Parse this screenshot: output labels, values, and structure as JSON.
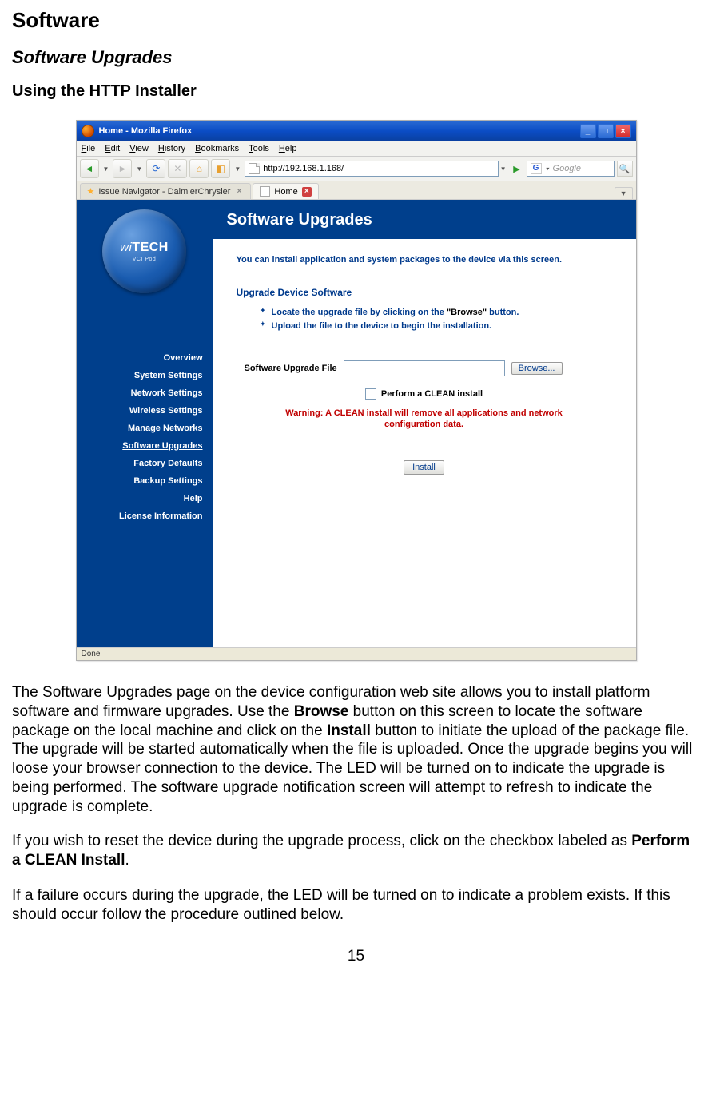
{
  "doc": {
    "h1": "Software",
    "h2": "Software Upgrades",
    "h3": "Using the HTTP Installer",
    "para1_a": "The Software Upgrades page on the device configuration web site allows you to install platform software and firmware upgrades.  Use the ",
    "para1_browse": "Browse",
    "para1_b": " button on this screen to locate the software package on the local machine and click on the ",
    "para1_install": "Install",
    "para1_c": " button to initiate the upload of the package file.  The upgrade will be started automatically when the file is uploaded.  Once the upgrade begins you will loose your browser connection to the device.  The LED will be turned on to indicate the upgrade is being performed.  The software upgrade notification screen will attempt to refresh to indicate the upgrade is complete.",
    "para2_a": "If you wish to reset the device during the upgrade process, click on the checkbox labeled as ",
    "para2_bold": "Perform a CLEAN Install",
    "para2_b": ".",
    "para3": "If a failure occurs during the upgrade, the LED will be turned on to indicate a problem exists.  If this should occur follow the procedure outlined below.",
    "page_num": "15"
  },
  "browser": {
    "title": "Home - Mozilla Firefox",
    "menu": [
      "File",
      "Edit",
      "View",
      "History",
      "Bookmarks",
      "Tools",
      "Help"
    ],
    "url": "http://192.168.1.168/",
    "search_placeholder": "Google",
    "tabs": {
      "inactive": "Issue Navigator - DaimlerChrysler",
      "active": "Home"
    },
    "status": "Done"
  },
  "ui": {
    "logo_main": "wiTECH",
    "logo_sub": "VCI Pod",
    "panel_title": "Software Upgrades",
    "intro": "You can install application and system packages to the device via this screen.",
    "section": "Upgrade Device Software",
    "bullet1_a": "Locate the upgrade file by clicking on the ",
    "bullet1_q": "\"Browse\"",
    "bullet1_b": " button.",
    "bullet2": "Upload the file to the device to begin the installation.",
    "file_label": "Software Upgrade File",
    "browse_btn": "Browse...",
    "clean_label": "Perform a CLEAN install",
    "warning": "Warning: A CLEAN install will remove all applications and network configuration data.",
    "install_btn": "Install",
    "nav": [
      {
        "label": "Overview",
        "selected": false
      },
      {
        "label": "System Settings",
        "selected": false
      },
      {
        "label": "Network Settings",
        "selected": false
      },
      {
        "label": "Wireless Settings",
        "selected": false
      },
      {
        "label": "Manage Networks",
        "selected": false
      },
      {
        "label": "Software Upgrades",
        "selected": true
      },
      {
        "label": "Factory Defaults",
        "selected": false
      },
      {
        "label": "Backup Settings",
        "selected": false
      },
      {
        "label": "Help",
        "selected": false
      },
      {
        "label": "License Information",
        "selected": false
      }
    ]
  }
}
